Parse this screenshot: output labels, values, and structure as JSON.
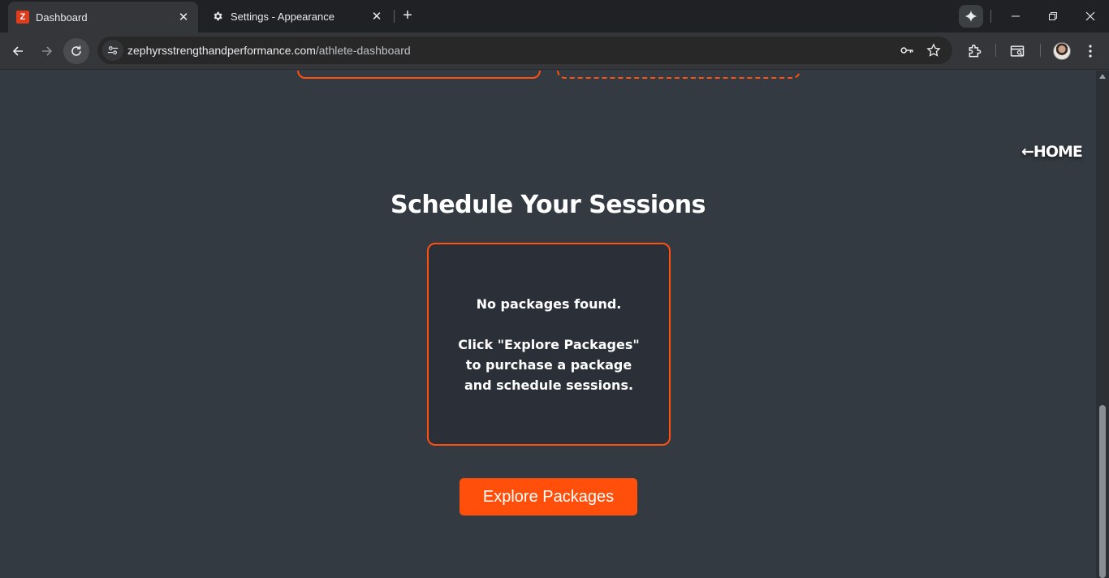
{
  "browser": {
    "tabs": [
      {
        "title": "Dashboard",
        "favicon": "Z",
        "active": true
      },
      {
        "title": "Settings - Appearance",
        "favicon": "gear-icon",
        "active": false
      }
    ],
    "url_host": "zephyrsstrengthandperformance.com",
    "url_path": "/athlete-dashboard",
    "accent": "#ff5010"
  },
  "page": {
    "home_link": "←HOME",
    "section_title": "Schedule Your Sessions",
    "empty_title": "No packages found.",
    "empty_message": "Click \"Explore Packages\" to purchase a package and schedule sessions.",
    "explore_button": "Explore Packages"
  }
}
